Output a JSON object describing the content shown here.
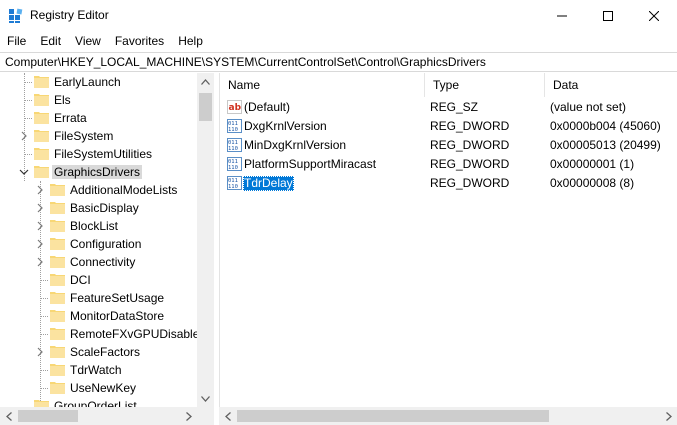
{
  "window": {
    "title": "Registry Editor"
  },
  "menu": [
    "File",
    "Edit",
    "View",
    "Favorites",
    "Help"
  ],
  "address": "Computer\\HKEY_LOCAL_MACHINE\\SYSTEM\\CurrentControlSet\\Control\\GraphicsDrivers",
  "tree": {
    "top_items": [
      {
        "label": "EarlyLaunch",
        "expandable": false
      },
      {
        "label": "Els",
        "expandable": false
      },
      {
        "label": "Errata",
        "expandable": false
      },
      {
        "label": "FileSystem",
        "expandable": true
      },
      {
        "label": "FileSystemUtilities",
        "expandable": false
      }
    ],
    "selected": {
      "label": "GraphicsDrivers",
      "expanded": true
    },
    "children": [
      {
        "label": "AdditionalModeLists",
        "expandable": true
      },
      {
        "label": "BasicDisplay",
        "expandable": true
      },
      {
        "label": "BlockList",
        "expandable": true
      },
      {
        "label": "Configuration",
        "expandable": true
      },
      {
        "label": "Connectivity",
        "expandable": true
      },
      {
        "label": "DCI",
        "expandable": false
      },
      {
        "label": "FeatureSetUsage",
        "expandable": false
      },
      {
        "label": "MonitorDataStore",
        "expandable": false
      },
      {
        "label": "RemoteFXvGPUDisabler",
        "expandable": false
      },
      {
        "label": "ScaleFactors",
        "expandable": true
      },
      {
        "label": "TdrWatch",
        "expandable": false
      },
      {
        "label": "UseNewKey",
        "expandable": false
      }
    ],
    "partial_next": {
      "label": "GroupOrderList"
    }
  },
  "list": {
    "headers": {
      "name": "Name",
      "type": "Type",
      "data": "Data"
    },
    "rows": [
      {
        "icon": "string-value-icon",
        "name": "(Default)",
        "type": "REG_SZ",
        "data": "(value not set)"
      },
      {
        "icon": "dword-value-icon",
        "name": "DxgKrnlVersion",
        "type": "REG_DWORD",
        "data": "0x0000b004 (45060)"
      },
      {
        "icon": "dword-value-icon",
        "name": "MinDxgKrnlVersion",
        "type": "REG_DWORD",
        "data": "0x00005013 (20499)"
      },
      {
        "icon": "dword-value-icon",
        "name": "PlatformSupportMiracast",
        "type": "REG_DWORD",
        "data": "0x00000001 (1)"
      },
      {
        "icon": "dword-value-icon",
        "name": "TdrDelay",
        "type": "REG_DWORD",
        "data": "0x00000008 (8)",
        "selected": true
      }
    ]
  },
  "colors": {
    "selection": "#0078d7",
    "folder": "#f8d775",
    "tree_selected_bg": "#d9d9d9"
  }
}
